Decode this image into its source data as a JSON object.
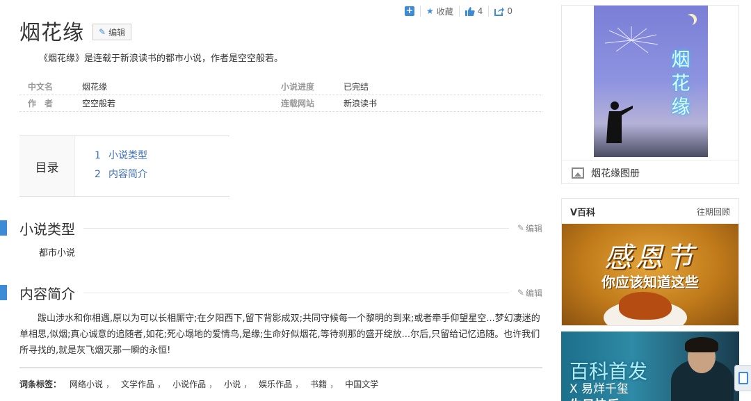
{
  "toolbar": {
    "favorite_label": "收藏",
    "like_count": "4",
    "share_count": "0"
  },
  "page": {
    "title": "烟花缘",
    "edit_label": "编辑",
    "summary": "《烟花缘》是连载于新浪读书的都市小说，作者是空空般若。"
  },
  "basic_info": {
    "rows": [
      {
        "key": "中文名",
        "value": "烟花缘",
        "key2": "小说进度",
        "value2": "已完结"
      },
      {
        "key": "作　者",
        "value": "空空般若",
        "key2": "连载网站",
        "value2": "新浪读书"
      }
    ]
  },
  "toc": {
    "label": "目录",
    "items": [
      {
        "num": "1",
        "label": "小说类型"
      },
      {
        "num": "2",
        "label": "内容简介"
      }
    ]
  },
  "sections": [
    {
      "heading": "小说类型",
      "edit": "编辑",
      "body": "都市小说"
    },
    {
      "heading": "内容简介",
      "edit": "编辑",
      "body": "跋山涉水和你相遇,原以为可以长相厮守;在夕阳西下,留下背影成双;共同守候每一个黎明的到来;或者牵手仰望星空...梦幻凄迷的单相思,似烟;真心诚意的追随者,如花;死心塌地的爱情鸟,是缘;生命好似烟花,等待刹那的盛开绽放...尔后,只留给记忆追随。也许我们所寻找的,就是灰飞烟灭那一瞬的永恒!"
    }
  ],
  "tags": {
    "label": "词条标签：",
    "items": [
      "网络小说",
      "文学作品",
      "小说作品",
      "小说",
      "娱乐作品",
      "书籍",
      "中国文学"
    ],
    "separator": "，"
  },
  "sidebar": {
    "cover_title": "烟花缘",
    "album_label": "烟花缘图册",
    "vbaike_title": "V百科",
    "vbaike_more": "往期回顾",
    "banner1_big": "感恩节",
    "banner1_sub": "你应该知道这些",
    "banner2_line1": "百科首发",
    "banner2_line2": "X 易烊千玺",
    "banner2_line3": "生日快乐"
  },
  "colors": {
    "accent": "#3d8bd6",
    "link": "#3d6fb8"
  },
  "icons": [
    "plus-icon",
    "star-icon",
    "thumbs-up-icon",
    "share-icon",
    "pencil-icon",
    "picture-icon"
  ]
}
